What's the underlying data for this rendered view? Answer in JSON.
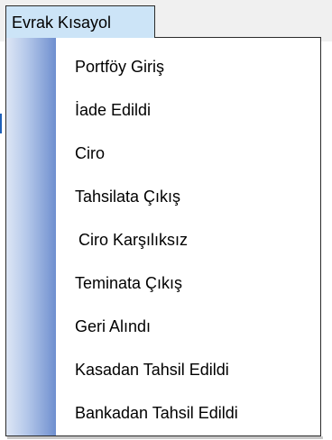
{
  "menu": {
    "title": "Evrak Kısayol"
  },
  "dropdown": {
    "items": [
      {
        "label": "Portföy Giriş"
      },
      {
        "label": "İade Edildi"
      },
      {
        "label": "Ciro"
      },
      {
        "label": "Tahsilata Çıkış"
      },
      {
        "label": "Ciro Karşılıksız"
      },
      {
        "label": "Teminata Çıkış"
      },
      {
        "label": "Geri Alındı"
      },
      {
        "label": "Kasadan Tahsil Edildi"
      },
      {
        "label": "Bankadan Tahsil Edildi"
      }
    ]
  },
  "colors": {
    "menu_tab_bg": "#cce4f7",
    "gutter_gradient_start": "#dde6f5",
    "gutter_gradient_end": "#6f8fcf",
    "border": "#2b2b2b"
  }
}
